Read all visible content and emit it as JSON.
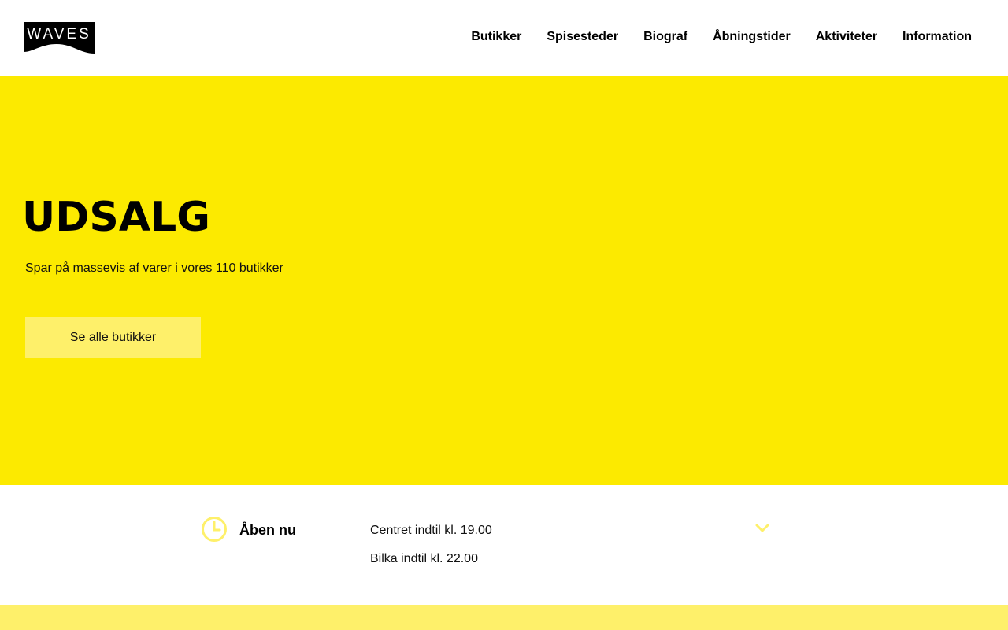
{
  "logo": {
    "text": "WAVES"
  },
  "nav": {
    "items": [
      {
        "label": "Butikker"
      },
      {
        "label": "Spisesteder"
      },
      {
        "label": "Biograf"
      },
      {
        "label": "Åbningstider"
      },
      {
        "label": "Aktiviteter"
      },
      {
        "label": "Information"
      }
    ]
  },
  "hero": {
    "title": "UDSALG",
    "subtitle": "Spar på massevis af varer i vores 110 butikker",
    "button_label": "Se alle butikker",
    "background_color": "#fcea00",
    "button_color": "#fef06a"
  },
  "opening_hours": {
    "label": "Åben nu",
    "lines": [
      "Centret indtil kl. 19.00",
      "Bilka indtil kl. 22.00"
    ],
    "icons": [
      "clock-icon",
      "chevron-down-icon"
    ],
    "accent_color": "#fef06a"
  }
}
